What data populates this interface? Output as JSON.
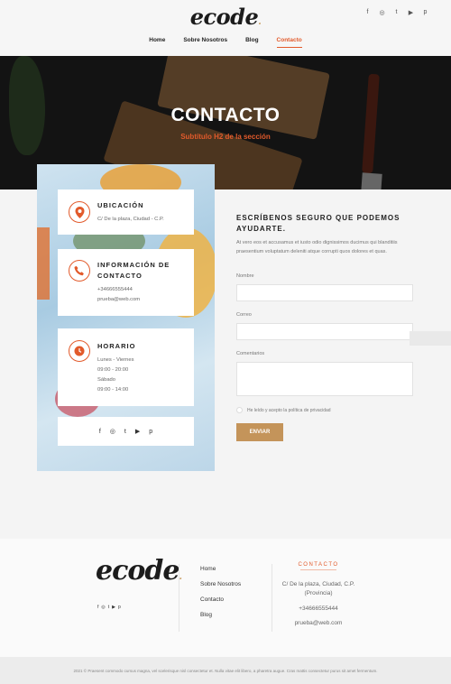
{
  "brand": {
    "logo": "ecode",
    "logo_dot": "."
  },
  "header": {
    "social": [
      "f",
      "◎",
      "t",
      "▶",
      "p"
    ],
    "nav": [
      {
        "label": "Home"
      },
      {
        "label": "Sobre Nosotros"
      },
      {
        "label": "Blog"
      },
      {
        "label": "Contacto",
        "active": true
      }
    ]
  },
  "hero": {
    "title": "CONTACTO",
    "subtitle": "Subtítulo H2 de la sección"
  },
  "cards": {
    "location": {
      "title": "UBICACIÓN",
      "lines": [
        "C/ De la plaza, Ciudad - C.P."
      ]
    },
    "info": {
      "title": "INFORMACIÓN DE CONTACTO",
      "lines": [
        "+34666555444",
        "prueba@web.com"
      ]
    },
    "hours": {
      "title": "HORARIO",
      "lines": [
        "Lunes - Viernes",
        "09:00 - 20:00",
        "Sábado",
        "09:00 - 14:00"
      ]
    },
    "social": [
      "f",
      "◎",
      "t",
      "▶",
      "p"
    ]
  },
  "form": {
    "title": "ESCRÍBENOS SEGURO QUE PODEMOS AYUDARTE.",
    "description": "At vero eos et accusamus et iusto odio dignissimos ducimus qui blanditiis praesentium voluptatum deleniti atque corrupti quos dolores et quas.",
    "name_label": "Nombre",
    "email_label": "Correo",
    "comments_label": "Comentarios",
    "privacy_label": "He leído y acepto la política de privacidad",
    "submit_label": "ENVIAR"
  },
  "footer": {
    "logo": "ecode",
    "social": [
      "f",
      "◎",
      "t",
      "▶",
      "p"
    ],
    "links": [
      "Home",
      "Sobre Nosotros",
      "Contacto",
      "Blog"
    ],
    "contact_title": "CONTACTO",
    "address": "C/ De la plaza, Ciudad, C.P. (Provincia)",
    "phone": "+34666555444",
    "email": "prueba@web.com",
    "copyright": "2021 © Praesent commodo cursus magna, vel scelerisque nisl consectetur et. Nulla vitae elit libero, a pharetra augue. Cras mattis consectetur purus sit amet fermentum."
  },
  "colors": {
    "accent": "#e25a2b",
    "button": "#c4945a",
    "dark": "#232323"
  }
}
